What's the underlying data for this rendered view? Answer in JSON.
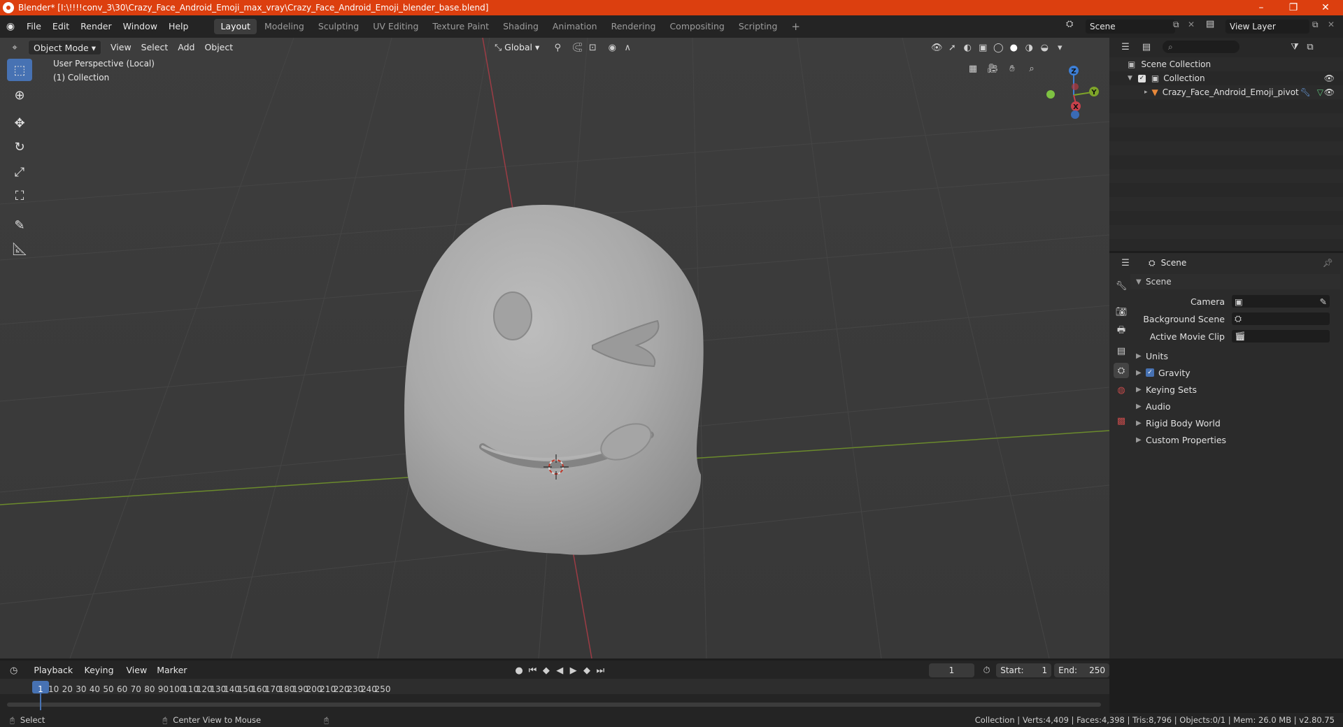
{
  "window": {
    "title": "Blender* [I:\\!!!!conv_3\\30\\Crazy_Face_Android_Emoji_max_vray\\Crazy_Face_Android_Emoji_blender_base.blend]",
    "minimize": "–",
    "maximize": "❐",
    "close": "✕"
  },
  "menu": {
    "items": [
      "File",
      "Edit",
      "Render",
      "Window",
      "Help"
    ]
  },
  "workspaces": {
    "tabs": [
      "Layout",
      "Modeling",
      "Sculpting",
      "UV Editing",
      "Texture Paint",
      "Shading",
      "Animation",
      "Rendering",
      "Compositing",
      "Scripting"
    ],
    "add": "+"
  },
  "scene_selector": {
    "value": "Scene"
  },
  "view_layer_selector": {
    "value": "View Layer"
  },
  "viewport_header": {
    "mode": "Object Mode",
    "menus": [
      "View",
      "Select",
      "Add",
      "Object"
    ],
    "transform_orientation": "Global"
  },
  "viewport": {
    "perspective_label": "User Perspective (Local)",
    "collection_label": "(1) Collection",
    "gizmo": {
      "z": "Z",
      "y": "Y",
      "x": "X"
    }
  },
  "outliner": {
    "rows": [
      {
        "label": "Scene Collection"
      },
      {
        "label": "Collection"
      },
      {
        "label": "Crazy_Face_Android_Emoji_pivot"
      }
    ]
  },
  "properties": {
    "header": "Scene",
    "panel_title": "Scene",
    "fields": [
      {
        "label": "Camera"
      },
      {
        "label": "Background Scene"
      },
      {
        "label": "Active Movie Clip"
      }
    ],
    "sections": [
      "Units",
      "Gravity",
      "Keying Sets",
      "Audio",
      "Rigid Body World",
      "Custom Properties"
    ],
    "gravity_checked": true
  },
  "timeline": {
    "menus": [
      "Playback",
      "Keying",
      "View",
      "Marker"
    ],
    "current_frame": "1",
    "start_label": "Start:",
    "start_value": "1",
    "end_label": "End:",
    "end_value": "250",
    "ruler": [
      "1",
      "10",
      "20",
      "30",
      "40",
      "50",
      "60",
      "70",
      "80",
      "90",
      "100",
      "110",
      "120",
      "130",
      "140",
      "150",
      "160",
      "170",
      "180",
      "190",
      "200",
      "210",
      "220",
      "230",
      "240",
      "250"
    ]
  },
  "statusbar": {
    "left_action": "Select",
    "middle_action": "Center View to Mouse",
    "stats": "Collection | Verts:4,409 | Faces:4,398 | Tris:8,796 | Objects:0/1 | Mem: 26.0 MB | v2.80.75"
  },
  "colors": {
    "titlebar": "#dc3f0f",
    "accent": "#4772b3",
    "viewport_bg": "#3a3a3a",
    "x_axis": "#c8414b",
    "y_axis": "#7ea429",
    "z_axis": "#3d7fd6"
  }
}
